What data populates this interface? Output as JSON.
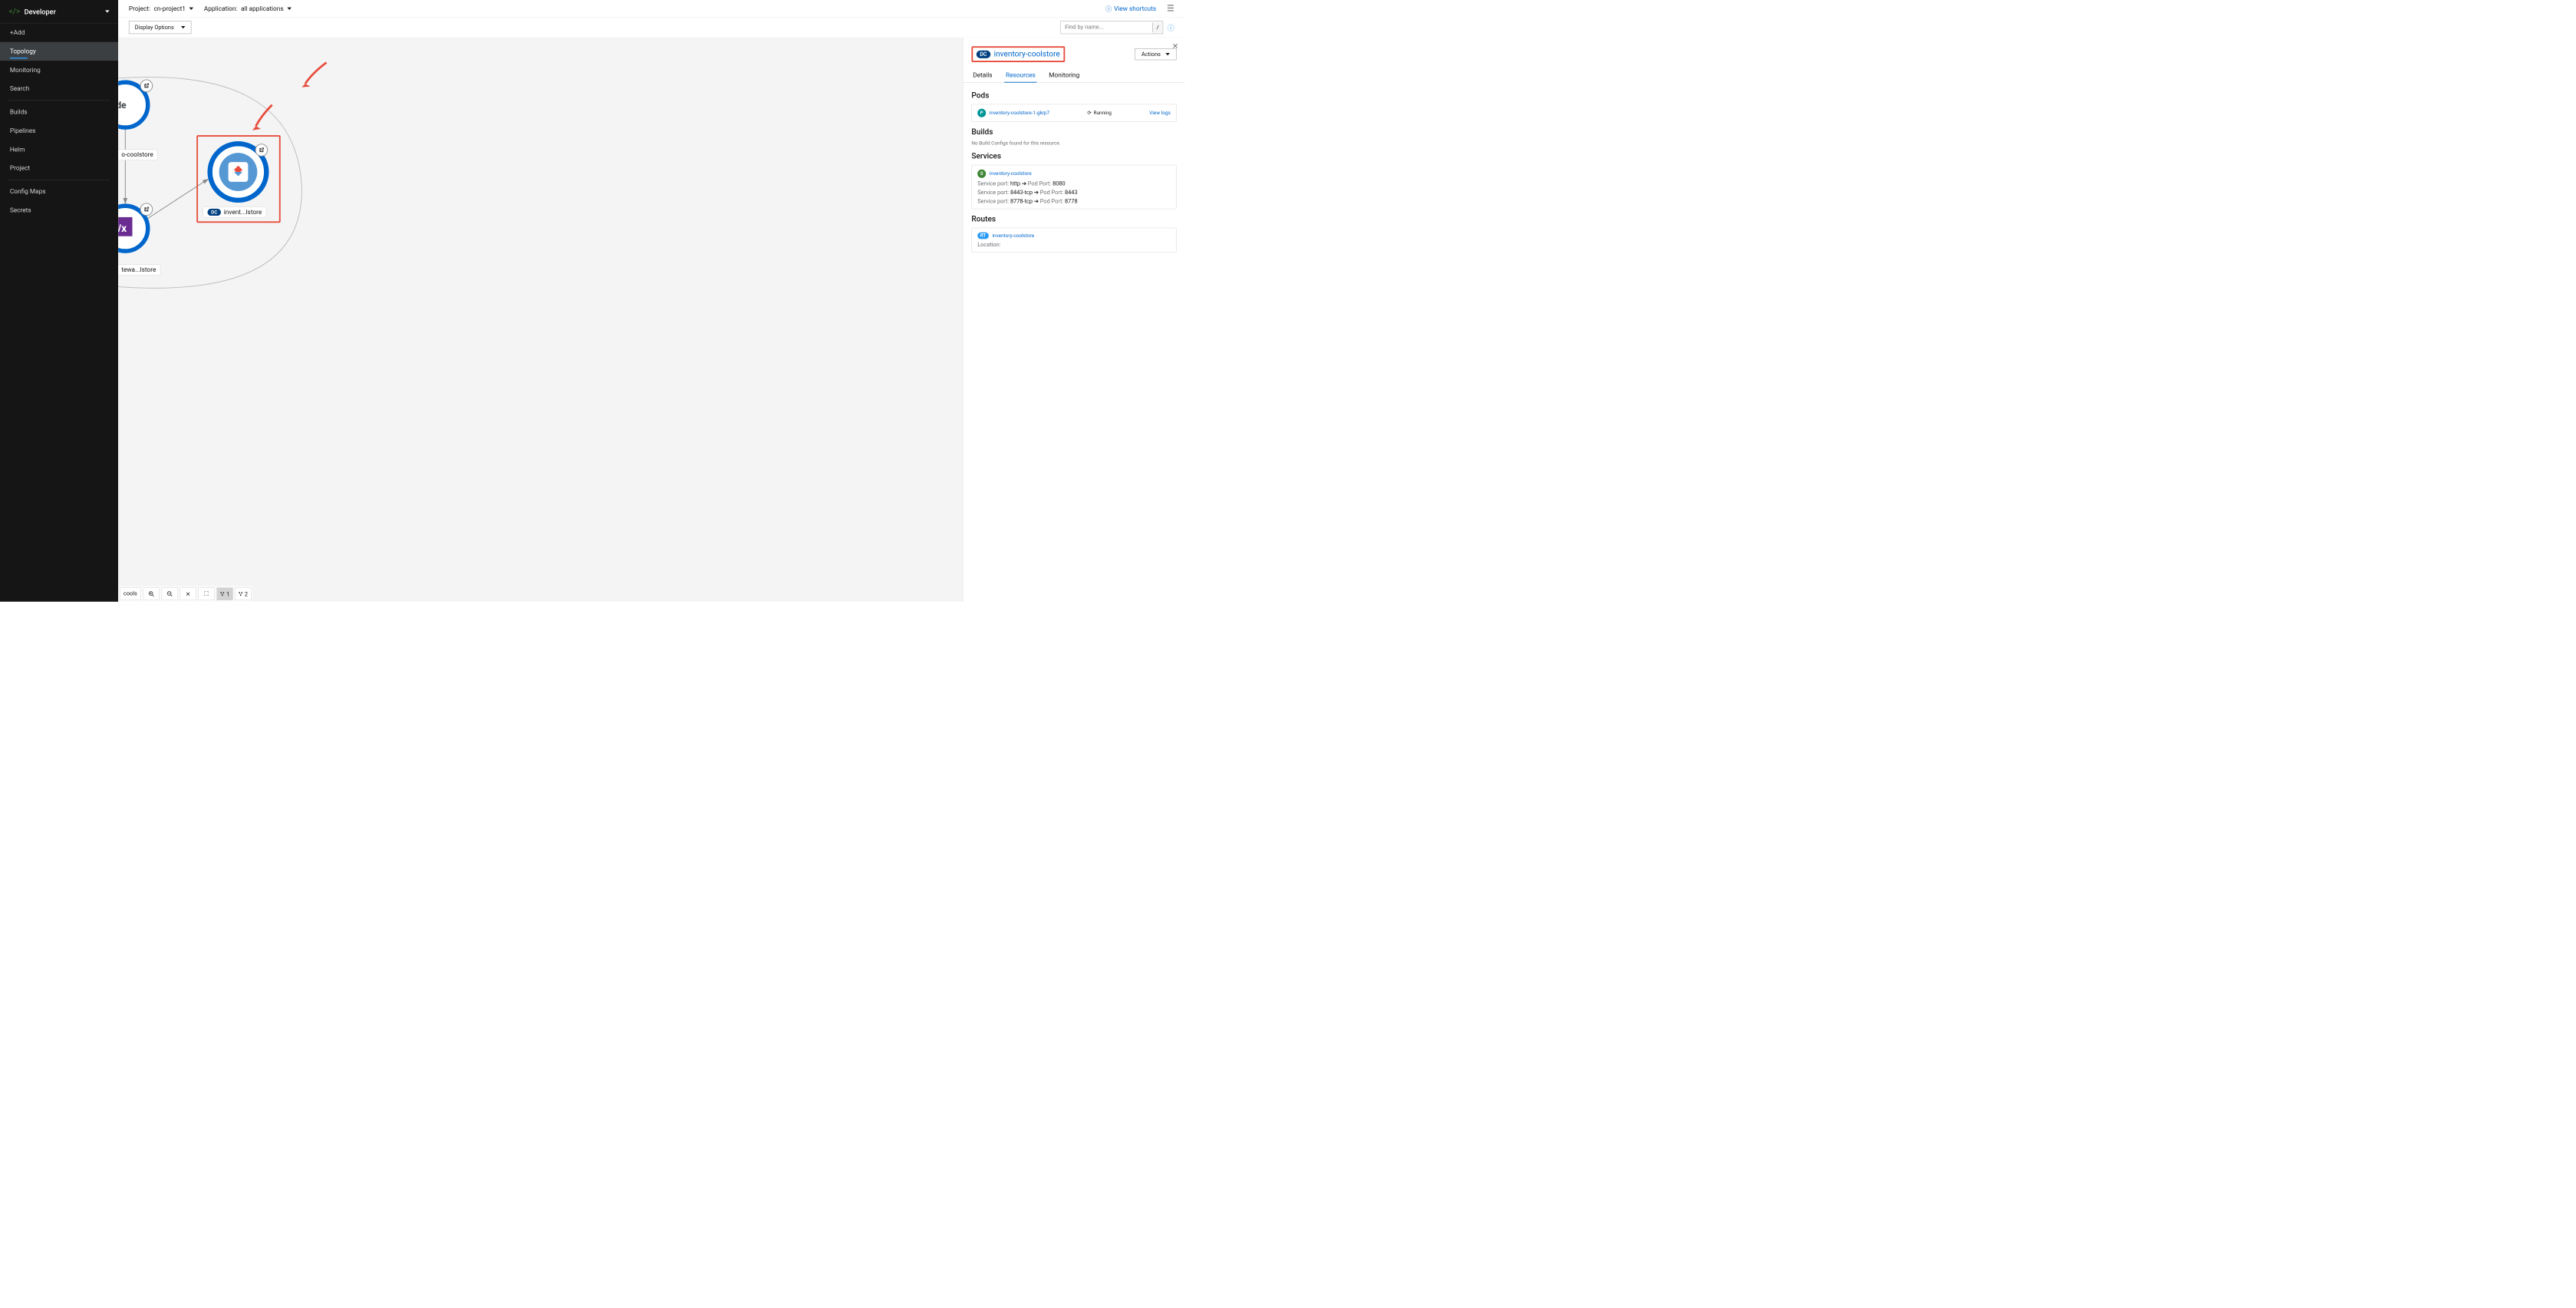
{
  "sidebar": {
    "header": "Developer",
    "items": [
      {
        "label": "+Add"
      },
      {
        "label": "Topology"
      },
      {
        "label": "Monitoring"
      },
      {
        "label": "Search"
      },
      {
        "label": "Builds"
      },
      {
        "label": "Pipelines"
      },
      {
        "label": "Helm"
      },
      {
        "label": "Project"
      },
      {
        "label": "Config Maps"
      },
      {
        "label": "Secrets"
      }
    ]
  },
  "topbar": {
    "project_label": "Project:",
    "project_value": "cn-project1",
    "app_label": "Application:",
    "app_value": "all applications",
    "shortcuts": "View shortcuts"
  },
  "toolbar": {
    "display_options": "Display Options",
    "search_placeholder": "Find by name...",
    "search_kbd": "/"
  },
  "canvas": {
    "node1_label_partial": "o-coolstore",
    "node2_label_partial": "tewa...lstore",
    "node3_badge": "DC",
    "node3_label": "invent...lstore",
    "bottom_left_label": "cools",
    "graph1": "1",
    "graph2": "2"
  },
  "panel": {
    "badge": "DC",
    "title": "inventory-coolstore",
    "actions": "Actions",
    "tabs": {
      "details": "Details",
      "resources": "Resources",
      "monitoring": "Monitoring"
    },
    "pods": {
      "heading": "Pods",
      "badge": "P",
      "name": "inventory-coolstore-1-gkrp7",
      "status": "Running",
      "logs": "View logs"
    },
    "builds": {
      "heading": "Builds",
      "empty": "No Build Configs found for this resource."
    },
    "services": {
      "heading": "Services",
      "badge": "S",
      "name": "inventory-coolstore",
      "port_label": "Service port:",
      "pod_port_label": "Pod Port:",
      "ports": [
        {
          "svc": "http",
          "pod": "8080"
        },
        {
          "svc": "8443-tcp",
          "pod": "8443"
        },
        {
          "svc": "8778-tcp",
          "pod": "8778"
        }
      ]
    },
    "routes": {
      "heading": "Routes",
      "badge": "RT",
      "name": "inventory-coolstore",
      "location_label": "Location:"
    }
  }
}
